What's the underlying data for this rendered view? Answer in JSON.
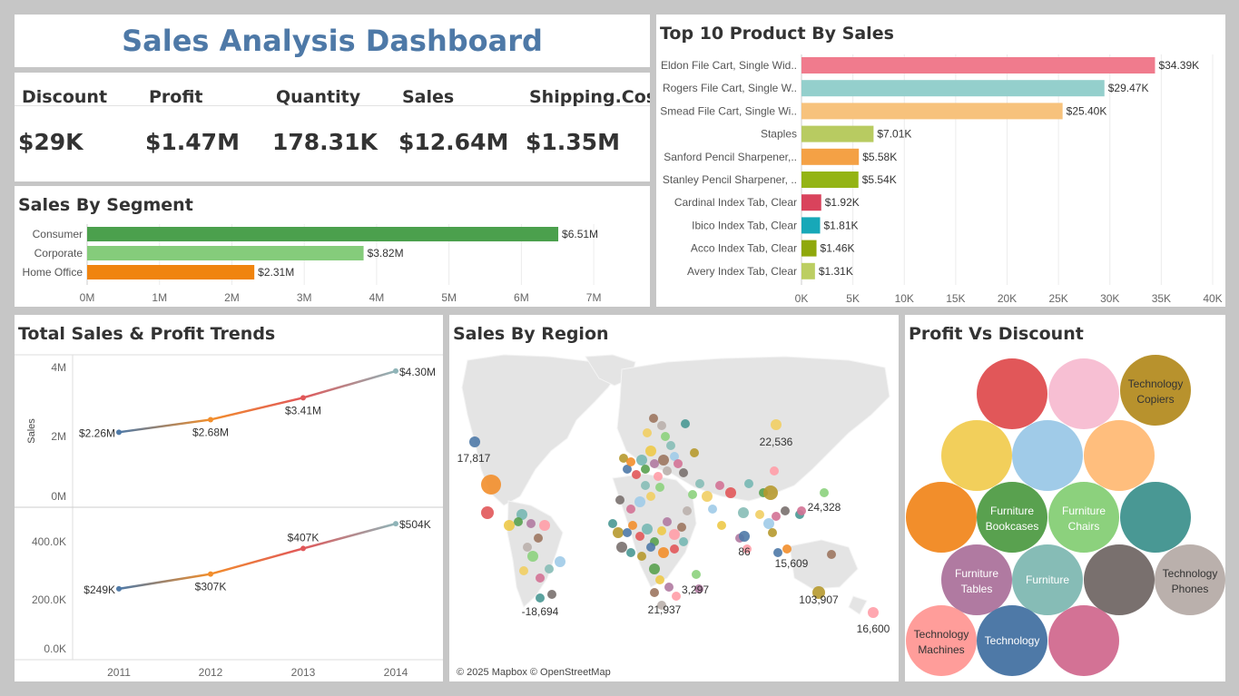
{
  "title": "Sales Analysis Dashboard",
  "kpis": [
    {
      "label": "Discount",
      "value": "$29K"
    },
    {
      "label": "Profit",
      "value": "$1.47M"
    },
    {
      "label": "Quantity",
      "value": "178.31K"
    },
    {
      "label": "Sales",
      "value": "$12.64M"
    },
    {
      "label": "Shipping.Cost",
      "value": "$1.35M"
    }
  ],
  "segment": {
    "title": "Sales By Segment",
    "chart_data": {
      "type": "bar",
      "orientation": "horizontal",
      "categories": [
        "Consumer",
        "Corporate",
        "Home Office"
      ],
      "values": [
        6.51,
        3.82,
        2.31
      ],
      "value_labels": [
        "$6.51M",
        "$3.82M",
        "$2.31M"
      ],
      "colors": [
        "#4ba04d",
        "#85cc7b",
        "#f0840f"
      ],
      "xticks": [
        "0M",
        "1M",
        "2M",
        "3M",
        "4M",
        "5M",
        "6M",
        "7M"
      ],
      "xlim": [
        0,
        7.4
      ],
      "grid": true
    }
  },
  "top10": {
    "title": "Top 10 Product By Sales",
    "chart_data": {
      "type": "bar",
      "orientation": "horizontal",
      "categories": [
        "Eldon File Cart, Single Wid..",
        "Rogers File Cart, Single W..",
        "Smead File Cart, Single Wi..",
        "Staples",
        "Sanford Pencil Sharpener,..",
        "Stanley Pencil Sharpener, ..",
        "Cardinal Index Tab, Clear",
        "Ibico Index Tab, Clear",
        "Acco Index Tab, Clear",
        "Avery Index Tab, Clear"
      ],
      "values": [
        34.39,
        29.47,
        25.4,
        7.01,
        5.58,
        5.54,
        1.92,
        1.81,
        1.46,
        1.31
      ],
      "value_labels": [
        "$34.39K",
        "$29.47K",
        "$25.40K",
        "$7.01K",
        "$5.58K",
        "$5.54K",
        "$1.92K",
        "$1.81K",
        "$1.46K",
        "$1.31K"
      ],
      "colors": [
        "#f07b8d",
        "#94cfcc",
        "#f7c27c",
        "#b8cb61",
        "#f4a145",
        "#94b414",
        "#d9435c",
        "#17a8b8",
        "#8fa80c",
        "#bcce62"
      ],
      "xticks": [
        "0K",
        "5K",
        "10K",
        "15K",
        "20K",
        "25K",
        "30K",
        "35K",
        "40K"
      ],
      "xlim": [
        0,
        40
      ],
      "grid": true
    }
  },
  "trends": {
    "title": "Total Sales & Profit Trends",
    "chart_data": [
      {
        "type": "line",
        "ylabel": "Sales",
        "x": [
          "2011",
          "2012",
          "2013",
          "2014"
        ],
        "values": [
          2.26,
          2.68,
          3.41,
          4.3
        ],
        "labels": [
          "$2.26M",
          "$2.68M",
          "$3.41M",
          "$4.30M"
        ],
        "yticks": [
          "4M",
          "2M",
          "0M"
        ],
        "ylim": [
          0,
          4.6
        ]
      },
      {
        "type": "line",
        "ylabel": "",
        "x": [
          "2011",
          "2012",
          "2013",
          "2014"
        ],
        "values": [
          249,
          307,
          407,
          504
        ],
        "labels": [
          "$249K",
          "$307K",
          "$407K",
          "$504K"
        ],
        "yticks": [
          "400.0K",
          "200.0K",
          "0.0K"
        ],
        "ylim": [
          0,
          540
        ]
      }
    ]
  },
  "region": {
    "title": "Sales By Region",
    "attribution": "© 2025 Mapbox © OpenStreetMap",
    "labels": [
      "17,817",
      "22,536",
      "24,328",
      "86",
      "15,609",
      "103,907",
      "16,600",
      "3,297",
      "21,937",
      "-18,694"
    ]
  },
  "pvd": {
    "title": "Profit Vs Discount",
    "bubbles": [
      {
        "label": "",
        "color": "#e15759"
      },
      {
        "label": "",
        "color": "#f7bfd3"
      },
      {
        "label": "Technology Copiers",
        "color": "#b8922d"
      },
      {
        "label": "",
        "color": "#f2cf5b"
      },
      {
        "label": "",
        "color": "#a0cbe8"
      },
      {
        "label": "",
        "color": "#ffbe7d"
      },
      {
        "label": "",
        "color": "#f28e2b"
      },
      {
        "label": "Furniture Bookcases",
        "color": "#59a14f"
      },
      {
        "label": "Furniture Chairs",
        "color": "#8cd17d"
      },
      {
        "label": "",
        "color": "#499894"
      },
      {
        "label": "Furniture Tables",
        "color": "#b07aa1"
      },
      {
        "label": "Furniture",
        "color": "#86bcb6"
      },
      {
        "label": "",
        "color": "#79706e"
      },
      {
        "label": "Technology Phones",
        "color": "#bab0ac"
      },
      {
        "label": "Technology Machines",
        "color": "#ff9d9a"
      },
      {
        "label": "Technology",
        "color": "#4e79a7"
      },
      {
        "label": "",
        "color": "#d37295"
      }
    ]
  }
}
